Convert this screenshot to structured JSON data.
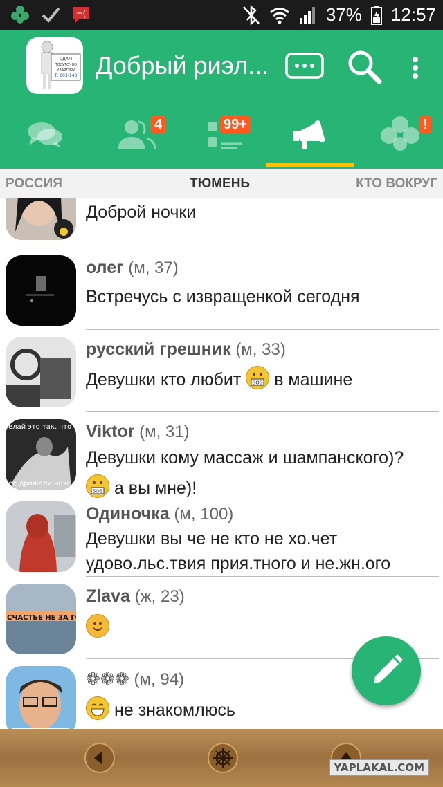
{
  "statusbar": {
    "battery": "37%",
    "time": "12:57"
  },
  "appbar": {
    "title": "Добрый риэл...",
    "logo_text": [
      "СДАМ",
      "ПОСУТОЧНО",
      "КВАРТИРУ",
      "Т. 603-143"
    ],
    "colors": {
      "primary": "#27b474",
      "accent": "#ffc107",
      "badge": "#ff5a1f"
    }
  },
  "tabs": [
    {
      "name": "chats",
      "badge": ""
    },
    {
      "name": "contacts",
      "badge": "4"
    },
    {
      "name": "feed",
      "badge": "99+"
    },
    {
      "name": "broadcasts",
      "badge": ""
    },
    {
      "name": "people",
      "badge": "!"
    }
  ],
  "subtabs": [
    "РОССИЯ",
    "ТЮМЕНЬ",
    "КТО ВОКРУГ"
  ],
  "posts": [
    {
      "name": "",
      "meta": "",
      "message": "Доброй ночки"
    },
    {
      "name": "олег",
      "meta": "(м, 37)",
      "message": "Встречусь с извращенкой сегодня"
    },
    {
      "name": "русский грешник",
      "meta": "(м, 33)",
      "message_before": "Девушки кто любит",
      "message_after": "в машине"
    },
    {
      "name": "Viktor",
      "meta": "(м, 31)",
      "message": "Девушки кому массаж и шампанского)?",
      "message2": "а вы мне)!",
      "avatar_caption_top": "елай это так, что",
      "avatar_caption_bottom": "ее дрожали нож"
    },
    {
      "name": "Одиночка",
      "meta": "(м, 100)",
      "message": "Девушки вы че не кто не хо.чет удово.льс.твия прия.тного и не.жн.ого"
    },
    {
      "name": "Zlava",
      "meta": "(ж, 23)",
      "avatar_caption": "СЧАСТЬЕ НЕ ЗА ГОРАМИ"
    },
    {
      "name": "❁❁❁",
      "meta": "(м, 94)",
      "message": "не знакомлюсь"
    }
  ],
  "watermark": "YAPLAKAL.COM"
}
